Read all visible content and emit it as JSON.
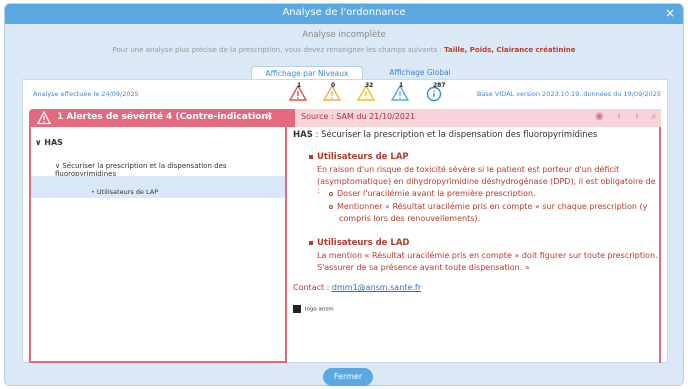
{
  "window": {
    "title": "Analyse de l'ordonnance",
    "close": "×",
    "subtitle": "Analyse incomplète",
    "notice_prefix": "Pour une analyse plus précise de la prescription, vous devez renseigner les champs suivants :",
    "notice_fields": "Taille, Poids, Clairance créatinine"
  },
  "tabs": {
    "active": "Affichage par Niveaux",
    "global": "Affichage Global"
  },
  "meta": {
    "analysis_date": "Analyse effectuée le  24/09/2025",
    "base_version": "Base VIDAL version  2023.10.19, données du 19/09/2025"
  },
  "alert_icons": [
    {
      "name": "severity-4-icon",
      "count": "1",
      "color": "#d9534f"
    },
    {
      "name": "severity-3-icon",
      "count": "0",
      "color": "#f0ad4e"
    },
    {
      "name": "severity-2-icon",
      "count": "32",
      "color": "#f4d03f"
    },
    {
      "name": "severity-1-icon",
      "count": "1",
      "color": "#5aa9e0"
    },
    {
      "name": "info-icon",
      "count": "287",
      "color": "#3b8ad0"
    }
  ],
  "alert_header": {
    "title": "1 Alertes de sévérité 4 (Contre-indication)",
    "close": "×",
    "source": "Source : SAM du 21/10/2021"
  },
  "tree": {
    "root": "HAS",
    "section": "Sécuriser la prescription et la dispensation des fluoropyrimidines",
    "item": "Utilisateurs de LAP"
  },
  "detail": {
    "heading_label": "HAS",
    "heading_text": " : Sécuriser la prescription et la dispensation des fluoropyrimidines",
    "lap_title": "Utilisateurs de LAP",
    "lap_text_1": "En raison d'un risque de toxicité sévère si le patient est porteur d'un déficit",
    "lap_text_2": "(asymptomatique) en dihydropyrimidine déshydrogénase (DPD), il est obligatoire de :",
    "lap_sub_1": "Doser l'uracilémie avant la première prescription.",
    "lap_sub_2a": "Mentionner « Résultat uracilémie pris en compte » sur chaque prescription (y",
    "lap_sub_2b": "compris lors des renouvellements).",
    "lad_title": "Utilisateurs de LAD",
    "lad_text_1": "La mention « Résultat uracilémie pris en compte » doit figurer sur toute prescription.",
    "lad_text_2": "S'assurer de sa présence avant toute dispensation. »",
    "contact_label": "Contact : ",
    "contact_email": "dmm1@ansm.sante.fr",
    "logo_text": "logo ansm"
  },
  "footer": {
    "close_button": "Fermer"
  }
}
